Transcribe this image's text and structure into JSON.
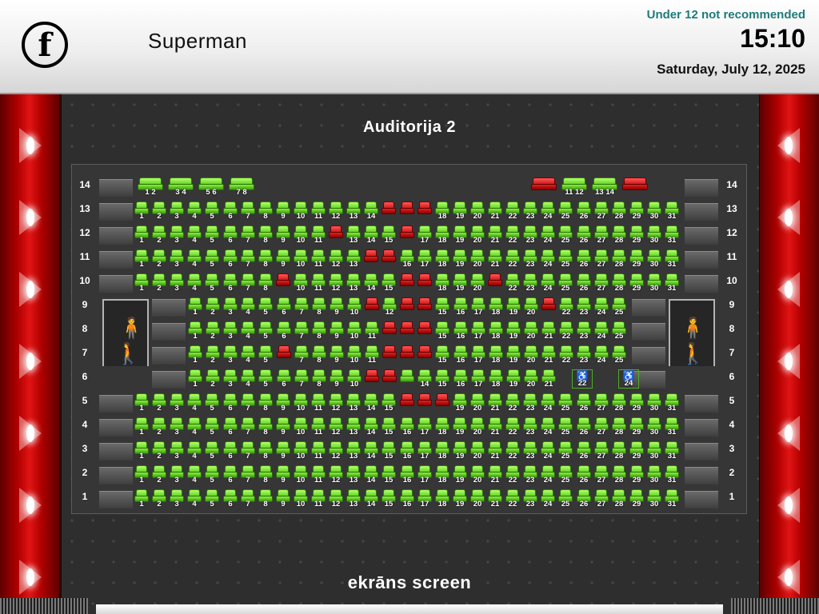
{
  "header": {
    "logo_letter": "f",
    "movie_title": "Superman",
    "rating": "Under 12 not recommended",
    "time": "15:10",
    "date": "Saturday, July 12, 2025"
  },
  "auditorium": {
    "name": "Auditorija 2"
  },
  "screen": {
    "label": "ekrāns screen"
  },
  "legend_colors": {
    "free": "#5fd41c",
    "occupied": "#d30d0d",
    "accessible_outline": "#4caf22"
  },
  "icons": {
    "entrance_left": "walking-person-icon",
    "entrance_right": "walking-person-icon",
    "accessible": "wheelchair-icon"
  },
  "row_labels": [
    "14",
    "13",
    "12",
    "11",
    "10",
    "9",
    "8",
    "7",
    "6",
    "5",
    "4",
    "3",
    "2",
    "1"
  ],
  "rows": [
    {
      "row": "14",
      "seats": [
        {
          "n": "1 2",
          "s": "free",
          "w": true
        },
        {
          "n": "3 4",
          "s": "free",
          "w": true
        },
        {
          "n": "5 6",
          "s": "free",
          "w": true
        },
        {
          "n": "7 8",
          "s": "free",
          "w": true
        },
        {
          "n": "",
          "s": "occupied",
          "w": true,
          "gap": 18
        },
        {
          "n": "11 12",
          "s": "free",
          "w": true
        },
        {
          "n": "13 14",
          "s": "free",
          "w": true
        },
        {
          "n": "",
          "s": "occupied",
          "w": true
        }
      ]
    },
    {
      "row": "13",
      "seats": [
        {
          "n": "1",
          "s": "free"
        },
        {
          "n": "2",
          "s": "free"
        },
        {
          "n": "3",
          "s": "free"
        },
        {
          "n": "4",
          "s": "free"
        },
        {
          "n": "5",
          "s": "free"
        },
        {
          "n": "6",
          "s": "free"
        },
        {
          "n": "7",
          "s": "free"
        },
        {
          "n": "8",
          "s": "free"
        },
        {
          "n": "9",
          "s": "free"
        },
        {
          "n": "10",
          "s": "free"
        },
        {
          "n": "11",
          "s": "free"
        },
        {
          "n": "12",
          "s": "free"
        },
        {
          "n": "13",
          "s": "free"
        },
        {
          "n": "14",
          "s": "free"
        },
        {
          "n": "",
          "s": "occupied"
        },
        {
          "n": "",
          "s": "occupied"
        },
        {
          "n": "",
          "s": "occupied"
        },
        {
          "n": "18",
          "s": "free"
        },
        {
          "n": "19",
          "s": "free"
        },
        {
          "n": "20",
          "s": "free"
        },
        {
          "n": "21",
          "s": "free"
        },
        {
          "n": "22",
          "s": "free"
        },
        {
          "n": "23",
          "s": "free"
        },
        {
          "n": "24",
          "s": "free"
        },
        {
          "n": "25",
          "s": "free"
        },
        {
          "n": "26",
          "s": "free"
        },
        {
          "n": "27",
          "s": "free"
        },
        {
          "n": "28",
          "s": "free"
        },
        {
          "n": "29",
          "s": "free"
        },
        {
          "n": "30",
          "s": "free"
        },
        {
          "n": "31",
          "s": "free"
        }
      ]
    },
    {
      "row": "12",
      "seats": [
        {
          "n": "1",
          "s": "free"
        },
        {
          "n": "2",
          "s": "free"
        },
        {
          "n": "3",
          "s": "free"
        },
        {
          "n": "4",
          "s": "free"
        },
        {
          "n": "5",
          "s": "free"
        },
        {
          "n": "6",
          "s": "free"
        },
        {
          "n": "7",
          "s": "free"
        },
        {
          "n": "8",
          "s": "free"
        },
        {
          "n": "9",
          "s": "free"
        },
        {
          "n": "10",
          "s": "free"
        },
        {
          "n": "11",
          "s": "free"
        },
        {
          "n": "",
          "s": "occupied"
        },
        {
          "n": "13",
          "s": "free"
        },
        {
          "n": "14",
          "s": "free"
        },
        {
          "n": "15",
          "s": "free"
        },
        {
          "n": "",
          "s": "occupied"
        },
        {
          "n": "17",
          "s": "free"
        },
        {
          "n": "18",
          "s": "free"
        },
        {
          "n": "19",
          "s": "free"
        },
        {
          "n": "20",
          "s": "free"
        },
        {
          "n": "21",
          "s": "free"
        },
        {
          "n": "22",
          "s": "free"
        },
        {
          "n": "23",
          "s": "free"
        },
        {
          "n": "24",
          "s": "free"
        },
        {
          "n": "25",
          "s": "free"
        },
        {
          "n": "26",
          "s": "free"
        },
        {
          "n": "27",
          "s": "free"
        },
        {
          "n": "28",
          "s": "free"
        },
        {
          "n": "29",
          "s": "free"
        },
        {
          "n": "30",
          "s": "free"
        },
        {
          "n": "31",
          "s": "free"
        }
      ]
    },
    {
      "row": "11",
      "seats": [
        {
          "n": "1",
          "s": "free"
        },
        {
          "n": "2",
          "s": "free"
        },
        {
          "n": "3",
          "s": "free"
        },
        {
          "n": "4",
          "s": "free"
        },
        {
          "n": "5",
          "s": "free"
        },
        {
          "n": "6",
          "s": "free"
        },
        {
          "n": "7",
          "s": "free"
        },
        {
          "n": "8",
          "s": "free"
        },
        {
          "n": "9",
          "s": "free"
        },
        {
          "n": "10",
          "s": "free"
        },
        {
          "n": "11",
          "s": "free"
        },
        {
          "n": "12",
          "s": "free"
        },
        {
          "n": "13",
          "s": "free"
        },
        {
          "n": "",
          "s": "occupied"
        },
        {
          "n": "",
          "s": "occupied"
        },
        {
          "n": "16",
          "s": "free"
        },
        {
          "n": "17",
          "s": "free"
        },
        {
          "n": "18",
          "s": "free"
        },
        {
          "n": "19",
          "s": "free"
        },
        {
          "n": "20",
          "s": "free"
        },
        {
          "n": "21",
          "s": "free"
        },
        {
          "n": "22",
          "s": "free"
        },
        {
          "n": "23",
          "s": "free"
        },
        {
          "n": "24",
          "s": "free"
        },
        {
          "n": "25",
          "s": "free"
        },
        {
          "n": "26",
          "s": "free"
        },
        {
          "n": "27",
          "s": "free"
        },
        {
          "n": "28",
          "s": "free"
        },
        {
          "n": "29",
          "s": "free"
        },
        {
          "n": "30",
          "s": "free"
        },
        {
          "n": "31",
          "s": "free"
        }
      ]
    },
    {
      "row": "10",
      "seats": [
        {
          "n": "1",
          "s": "free"
        },
        {
          "n": "2",
          "s": "free"
        },
        {
          "n": "3",
          "s": "free"
        },
        {
          "n": "4",
          "s": "free"
        },
        {
          "n": "5",
          "s": "free"
        },
        {
          "n": "6",
          "s": "free"
        },
        {
          "n": "7",
          "s": "free"
        },
        {
          "n": "8",
          "s": "free"
        },
        {
          "n": "",
          "s": "occupied"
        },
        {
          "n": "10",
          "s": "free"
        },
        {
          "n": "11",
          "s": "free"
        },
        {
          "n": "12",
          "s": "free"
        },
        {
          "n": "13",
          "s": "free"
        },
        {
          "n": "14",
          "s": "free"
        },
        {
          "n": "15",
          "s": "free"
        },
        {
          "n": "",
          "s": "occupied"
        },
        {
          "n": "",
          "s": "occupied"
        },
        {
          "n": "18",
          "s": "free"
        },
        {
          "n": "19",
          "s": "free"
        },
        {
          "n": "20",
          "s": "free"
        },
        {
          "n": "",
          "s": "occupied"
        },
        {
          "n": "22",
          "s": "free"
        },
        {
          "n": "23",
          "s": "free"
        },
        {
          "n": "24",
          "s": "free"
        },
        {
          "n": "25",
          "s": "free"
        },
        {
          "n": "26",
          "s": "free"
        },
        {
          "n": "27",
          "s": "free"
        },
        {
          "n": "28",
          "s": "free"
        },
        {
          "n": "29",
          "s": "free"
        },
        {
          "n": "30",
          "s": "free"
        },
        {
          "n": "31",
          "s": "free"
        }
      ]
    },
    {
      "row": "9",
      "seats": [
        {
          "n": "1",
          "s": "free"
        },
        {
          "n": "2",
          "s": "free"
        },
        {
          "n": "3",
          "s": "free"
        },
        {
          "n": "4",
          "s": "free"
        },
        {
          "n": "5",
          "s": "free"
        },
        {
          "n": "6",
          "s": "free"
        },
        {
          "n": "7",
          "s": "free"
        },
        {
          "n": "8",
          "s": "free"
        },
        {
          "n": "9",
          "s": "free"
        },
        {
          "n": "10",
          "s": "free"
        },
        {
          "n": "",
          "s": "occupied"
        },
        {
          "n": "12",
          "s": "free"
        },
        {
          "n": "",
          "s": "occupied"
        },
        {
          "n": "",
          "s": "occupied"
        },
        {
          "n": "15",
          "s": "free"
        },
        {
          "n": "16",
          "s": "free"
        },
        {
          "n": "17",
          "s": "free"
        },
        {
          "n": "18",
          "s": "free"
        },
        {
          "n": "19",
          "s": "free"
        },
        {
          "n": "20",
          "s": "free"
        },
        {
          "n": "",
          "s": "occupied"
        },
        {
          "n": "22",
          "s": "free"
        },
        {
          "n": "23",
          "s": "free"
        },
        {
          "n": "24",
          "s": "free"
        },
        {
          "n": "25",
          "s": "free"
        }
      ]
    },
    {
      "row": "8",
      "seats": [
        {
          "n": "1",
          "s": "free"
        },
        {
          "n": "2",
          "s": "free"
        },
        {
          "n": "3",
          "s": "free"
        },
        {
          "n": "4",
          "s": "free"
        },
        {
          "n": "5",
          "s": "free"
        },
        {
          "n": "6",
          "s": "free"
        },
        {
          "n": "7",
          "s": "free"
        },
        {
          "n": "8",
          "s": "free"
        },
        {
          "n": "9",
          "s": "free"
        },
        {
          "n": "10",
          "s": "free"
        },
        {
          "n": "11",
          "s": "free"
        },
        {
          "n": "",
          "s": "occupied"
        },
        {
          "n": "",
          "s": "occupied"
        },
        {
          "n": "",
          "s": "occupied"
        },
        {
          "n": "15",
          "s": "free"
        },
        {
          "n": "16",
          "s": "free"
        },
        {
          "n": "17",
          "s": "free"
        },
        {
          "n": "18",
          "s": "free"
        },
        {
          "n": "19",
          "s": "free"
        },
        {
          "n": "20",
          "s": "free"
        },
        {
          "n": "21",
          "s": "free"
        },
        {
          "n": "22",
          "s": "free"
        },
        {
          "n": "23",
          "s": "free"
        },
        {
          "n": "24",
          "s": "free"
        },
        {
          "n": "25",
          "s": "free"
        }
      ]
    },
    {
      "row": "7",
      "seats": [
        {
          "n": "1",
          "s": "free"
        },
        {
          "n": "2",
          "s": "free"
        },
        {
          "n": "3",
          "s": "free"
        },
        {
          "n": "4",
          "s": "free"
        },
        {
          "n": "5",
          "s": "free"
        },
        {
          "n": "",
          "s": "occupied"
        },
        {
          "n": "7",
          "s": "free"
        },
        {
          "n": "8",
          "s": "free"
        },
        {
          "n": "9",
          "s": "free"
        },
        {
          "n": "10",
          "s": "free"
        },
        {
          "n": "11",
          "s": "free"
        },
        {
          "n": "",
          "s": "occupied"
        },
        {
          "n": "",
          "s": "occupied"
        },
        {
          "n": "",
          "s": "occupied"
        },
        {
          "n": "15",
          "s": "free"
        },
        {
          "n": "16",
          "s": "free"
        },
        {
          "n": "17",
          "s": "free"
        },
        {
          "n": "18",
          "s": "free"
        },
        {
          "n": "19",
          "s": "free"
        },
        {
          "n": "20",
          "s": "free"
        },
        {
          "n": "21",
          "s": "free"
        },
        {
          "n": "22",
          "s": "free"
        },
        {
          "n": "23",
          "s": "free"
        },
        {
          "n": "24",
          "s": "free"
        },
        {
          "n": "25",
          "s": "free"
        }
      ]
    },
    {
      "row": "6",
      "seats": [
        {
          "n": "1",
          "s": "free"
        },
        {
          "n": "2",
          "s": "free"
        },
        {
          "n": "3",
          "s": "free"
        },
        {
          "n": "4",
          "s": "free"
        },
        {
          "n": "5",
          "s": "free"
        },
        {
          "n": "6",
          "s": "free"
        },
        {
          "n": "7",
          "s": "free"
        },
        {
          "n": "8",
          "s": "free"
        },
        {
          "n": "9",
          "s": "free"
        },
        {
          "n": "10",
          "s": "free"
        },
        {
          "n": "",
          "s": "occupied",
          "gap": 1
        },
        {
          "n": "",
          "s": "occupied"
        },
        {
          "n": "",
          "s": "free"
        },
        {
          "n": "14",
          "s": "free"
        },
        {
          "n": "15",
          "s": "free"
        },
        {
          "n": "16",
          "s": "free"
        },
        {
          "n": "17",
          "s": "free"
        },
        {
          "n": "18",
          "s": "free"
        },
        {
          "n": "19",
          "s": "free"
        },
        {
          "n": "20",
          "s": "free"
        },
        {
          "n": "21",
          "s": "free"
        },
        {
          "n": "22",
          "s": "accessible",
          "gap": 1
        },
        {
          "n": "24",
          "s": "accessible",
          "gap": 1
        }
      ]
    },
    {
      "row": "5",
      "seats": [
        {
          "n": "1",
          "s": "free"
        },
        {
          "n": "2",
          "s": "free"
        },
        {
          "n": "3",
          "s": "free"
        },
        {
          "n": "4",
          "s": "free"
        },
        {
          "n": "5",
          "s": "free"
        },
        {
          "n": "6",
          "s": "free"
        },
        {
          "n": "7",
          "s": "free"
        },
        {
          "n": "8",
          "s": "free"
        },
        {
          "n": "9",
          "s": "free"
        },
        {
          "n": "10",
          "s": "free"
        },
        {
          "n": "11",
          "s": "free"
        },
        {
          "n": "12",
          "s": "free"
        },
        {
          "n": "13",
          "s": "free"
        },
        {
          "n": "14",
          "s": "free"
        },
        {
          "n": "15",
          "s": "free"
        },
        {
          "n": "",
          "s": "occupied"
        },
        {
          "n": "",
          "s": "occupied"
        },
        {
          "n": "",
          "s": "occupied"
        },
        {
          "n": "19",
          "s": "free"
        },
        {
          "n": "20",
          "s": "free"
        },
        {
          "n": "21",
          "s": "free"
        },
        {
          "n": "22",
          "s": "free"
        },
        {
          "n": "23",
          "s": "free"
        },
        {
          "n": "24",
          "s": "free"
        },
        {
          "n": "25",
          "s": "free"
        },
        {
          "n": "26",
          "s": "free"
        },
        {
          "n": "27",
          "s": "free"
        },
        {
          "n": "28",
          "s": "free"
        },
        {
          "n": "29",
          "s": "free"
        },
        {
          "n": "30",
          "s": "free"
        },
        {
          "n": "31",
          "s": "free"
        }
      ]
    },
    {
      "row": "4",
      "range": [
        1,
        31
      ],
      "occupied": []
    },
    {
      "row": "3",
      "range": [
        1,
        31
      ],
      "occupied": []
    },
    {
      "row": "2",
      "range": [
        1,
        31
      ],
      "occupied": []
    },
    {
      "row": "1",
      "range": [
        1,
        31
      ],
      "occupied": []
    }
  ]
}
